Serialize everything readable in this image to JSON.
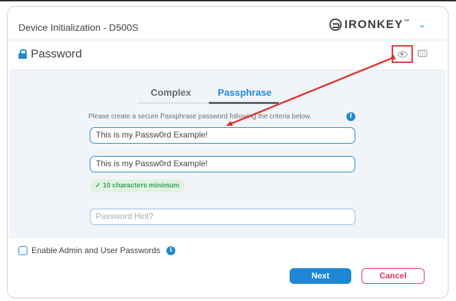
{
  "window": {
    "title": "Device Initialization - D500S",
    "brand": "IRONKEY",
    "brand_tm": "™"
  },
  "section": {
    "title": "Password"
  },
  "tabs": [
    {
      "label": "Complex",
      "active": false
    },
    {
      "label": "Passphrase",
      "active": true
    }
  ],
  "form": {
    "criteria_text": "Please create a secure Passphrase password following the criteria below.",
    "password_value": "This is my Passw0rd Example!",
    "confirm_value": "This is my Passw0rd Example!",
    "requirement_badge": "✓ 10 characters minimum",
    "hint_placeholder": "Password Hint?"
  },
  "options": {
    "enable_admin_label": "Enable Admin and User Passwords"
  },
  "buttons": {
    "next": "Next",
    "cancel": "Cancel"
  },
  "icons": {
    "info": "i",
    "chevron": "⌄"
  },
  "colors": {
    "accent": "#1e88d6",
    "cancel": "#d8335f",
    "success": "#3aa85a",
    "annotation": "#e0322c"
  }
}
